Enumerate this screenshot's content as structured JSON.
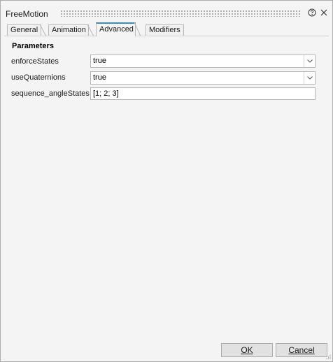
{
  "window": {
    "title": "FreeMotion",
    "help_icon": "help-circle-icon",
    "close_icon": "close-icon"
  },
  "tabs": [
    {
      "label": "General",
      "active": false
    },
    {
      "label": "Animation",
      "active": false
    },
    {
      "label": "Advanced",
      "active": true
    },
    {
      "label": "Modifiers",
      "active": false
    }
  ],
  "parameters": {
    "section_title": "Parameters",
    "rows": [
      {
        "label": "enforceStates",
        "type": "dropdown",
        "value": "true"
      },
      {
        "label": "useQuaternions",
        "type": "dropdown",
        "value": "true"
      },
      {
        "label": "sequence_angleStates",
        "type": "text",
        "value": "[1; 2; 3]"
      }
    ]
  },
  "footer": {
    "ok_label": "OK",
    "cancel_label": "Cancel"
  },
  "colors": {
    "active_tab_accent": "#3c8dbc",
    "background": "#f4f4f4"
  }
}
